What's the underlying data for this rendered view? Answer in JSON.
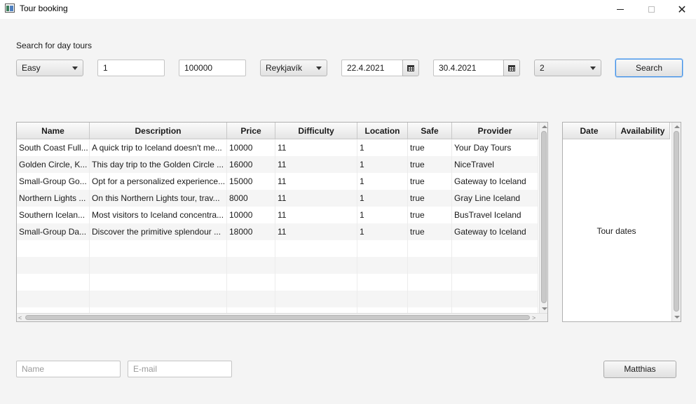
{
  "window": {
    "title": "Tour booking"
  },
  "search": {
    "label": "Search for day tours",
    "difficulty": "Easy",
    "min_price": "1",
    "max_price": "100000",
    "location": "Reykjavík",
    "date_from": "22.4.2021",
    "date_to": "30.4.2021",
    "people": "2",
    "button": "Search"
  },
  "tours_table": {
    "columns": [
      "Name",
      "Description",
      "Price",
      "Difficulty",
      "Location",
      "Safe",
      "Provider"
    ],
    "rows": [
      [
        "South Coast Full...",
        "A quick trip to Iceland doesn't me...",
        "10000",
        "11",
        "1",
        "true",
        "Your Day Tours"
      ],
      [
        "Golden Circle, K...",
        "This day trip to the Golden Circle ...",
        "16000",
        "11",
        "1",
        "true",
        "NiceTravel"
      ],
      [
        "Small-Group Go...",
        "Opt for a personalized experience...",
        "15000",
        "11",
        "1",
        "true",
        "Gateway to Iceland"
      ],
      [
        "Northern Lights ...",
        "On this Northern Lights tour, trav...",
        "8000",
        "11",
        "1",
        "true",
        "Gray Line Iceland"
      ],
      [
        "Southern Icelan...",
        "Most visitors to Iceland concentra...",
        "10000",
        "11",
        "1",
        "true",
        "BusTravel Iceland"
      ],
      [
        "Small-Group Da...",
        "Discover the primitive splendour ...",
        "18000",
        "11",
        "1",
        "true",
        "Gateway to Iceland"
      ]
    ]
  },
  "dates_table": {
    "columns": [
      "Date",
      "Availability"
    ],
    "placeholder": "Tour dates"
  },
  "booking": {
    "name_placeholder": "Name",
    "email_placeholder": "E-mail",
    "user_button": "Matthias"
  },
  "icons": {
    "app": "window-app-icon",
    "minimize": "minimize-icon",
    "maximize": "maximize-icon",
    "close": "close-icon",
    "calendar": "calendar-icon",
    "dropdown": "chevron-down-icon"
  },
  "colors": {
    "focus": "#3d8ee6",
    "background": "#f4f4f4"
  }
}
